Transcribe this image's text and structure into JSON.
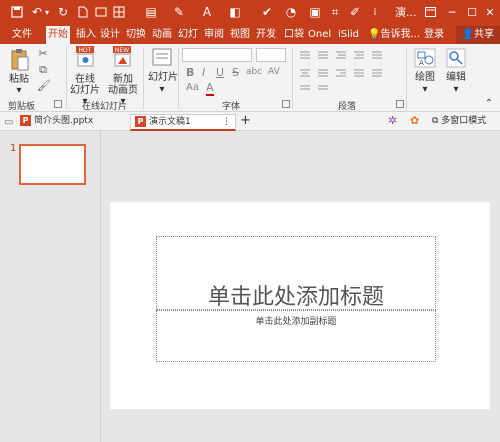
{
  "titlebar": {
    "title": "演...",
    "bg_color": "#c43e1c"
  },
  "quick_access": [
    {
      "icon": "save-icon",
      "glyph": "💾"
    },
    {
      "icon": "undo-icon",
      "glyph": "↶"
    },
    {
      "icon": "redo-icon",
      "glyph": "↻"
    },
    {
      "icon": "new-document-icon",
      "glyph": "🗋"
    },
    {
      "icon": "new-slide-icon",
      "glyph": "▭"
    },
    {
      "icon": "draw-icon",
      "glyph": "✎"
    },
    {
      "icon": "format-painter-icon",
      "glyph": "🖌"
    },
    {
      "icon": "arrange-icon",
      "glyph": "▤"
    },
    {
      "icon": "check-icon",
      "glyph": "✔"
    },
    {
      "icon": "clock-icon",
      "glyph": "◔"
    },
    {
      "icon": "window-icon",
      "glyph": "▣"
    }
  ],
  "tabs": [
    {
      "label": "文件"
    },
    {
      "label": "开始",
      "active": true
    },
    {
      "label": "插入"
    },
    {
      "label": "设计"
    },
    {
      "label": "切换"
    },
    {
      "label": "动画"
    },
    {
      "label": "幻灯"
    },
    {
      "label": "审阅"
    },
    {
      "label": "视图"
    },
    {
      "label": "开发"
    },
    {
      "label": "口袋"
    },
    {
      "label": "Onel"
    },
    {
      "label": "iSlid"
    },
    {
      "label": "告诉我..."
    },
    {
      "label": "登录"
    },
    {
      "label": "共享"
    }
  ],
  "ribbon": {
    "clipboard": {
      "paste_label": "粘贴",
      "group_label": "剪贴板"
    },
    "slides": {
      "online_label": "在线\n幻灯片",
      "new_anim_label": "新加\n动画页",
      "hot_badge": "HOT",
      "new_badge": "NEW",
      "group_label": "在线幻灯片"
    },
    "slide_layout": {
      "label": "幻灯片"
    },
    "font": {
      "group_label": "字体",
      "bold": "B",
      "italic": "I",
      "underline": "U",
      "strike": "S",
      "shadow": "abc",
      "spacing": "AV",
      "case": "Aa",
      "color": "A"
    },
    "paragraph": {
      "group_label": "段落"
    },
    "drawing": {
      "label": "绘图"
    },
    "editing": {
      "label": "编辑"
    }
  },
  "doctabs": [
    {
      "label": "简介头图.pptx",
      "active": false
    },
    {
      "label": "演示文稿1",
      "active": true
    }
  ],
  "doctab_extra": {
    "new_tab": "+",
    "multi_window": "多窗口模式"
  },
  "thumbnails": [
    {
      "number": "1"
    }
  ],
  "slide": {
    "title_placeholder": "单击此处添加标题",
    "subtitle_placeholder": "单击此处添加副标题"
  },
  "colors": {
    "accent": "#c43e1c",
    "thumb_border": "#e0643c",
    "ribbon_bg": "#f3f3f3",
    "workspace_bg": "#e6e6e6"
  }
}
